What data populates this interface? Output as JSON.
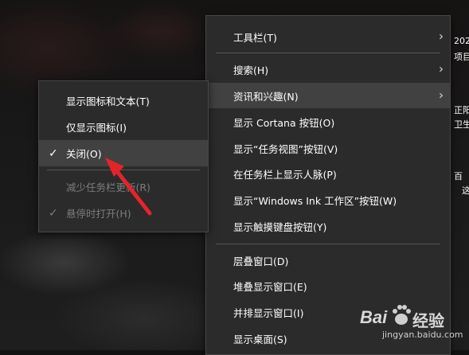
{
  "main_menu": {
    "items": [
      {
        "label": "工具栏(T)"
      },
      {
        "label": "搜索(H)"
      },
      {
        "label": "资讯和兴趣(N)"
      },
      {
        "label": "显示 Cortana 按钮(O)"
      },
      {
        "label": "显示“任务视图”按钮(V)"
      },
      {
        "label": "在任务栏上显示人脉(P)"
      },
      {
        "label": "显示“Windows Ink 工作区”按钮(W)"
      },
      {
        "label": "显示触摸键盘按钮(Y)"
      },
      {
        "label": "层叠窗口(D)"
      },
      {
        "label": "堆叠显示窗口(E)"
      },
      {
        "label": "并排显示窗口(I)"
      },
      {
        "label": "显示桌面(S)"
      }
    ]
  },
  "sub_menu": {
    "items": [
      {
        "label": "显示图标和文本(T)",
        "checked": false,
        "disabled": false
      },
      {
        "label": "仅显示图标(I)",
        "checked": false,
        "disabled": false
      },
      {
        "label": "关闭(O)",
        "checked": true,
        "disabled": false
      },
      {
        "label": "减少任务栏更新(R)",
        "checked": false,
        "disabled": true
      },
      {
        "label": "悬停时打开(H)",
        "checked": true,
        "disabled": true
      }
    ]
  },
  "glyphs": {
    "arrow": "›",
    "check": "✓"
  },
  "right_edge_text": [
    "202",
    "项目",
    "正阳",
    "卫生",
    "百",
    "这"
  ],
  "watermark": {
    "brand": "Bai",
    "brand2": "经验",
    "url": "jingyan.baidu.com"
  },
  "colors": {
    "menu_bg": "#2b2b2b",
    "hover_bg": "#414141",
    "text": "#ffffff",
    "disabled_text": "#7d7d7d",
    "annotation": "#e5242a"
  }
}
